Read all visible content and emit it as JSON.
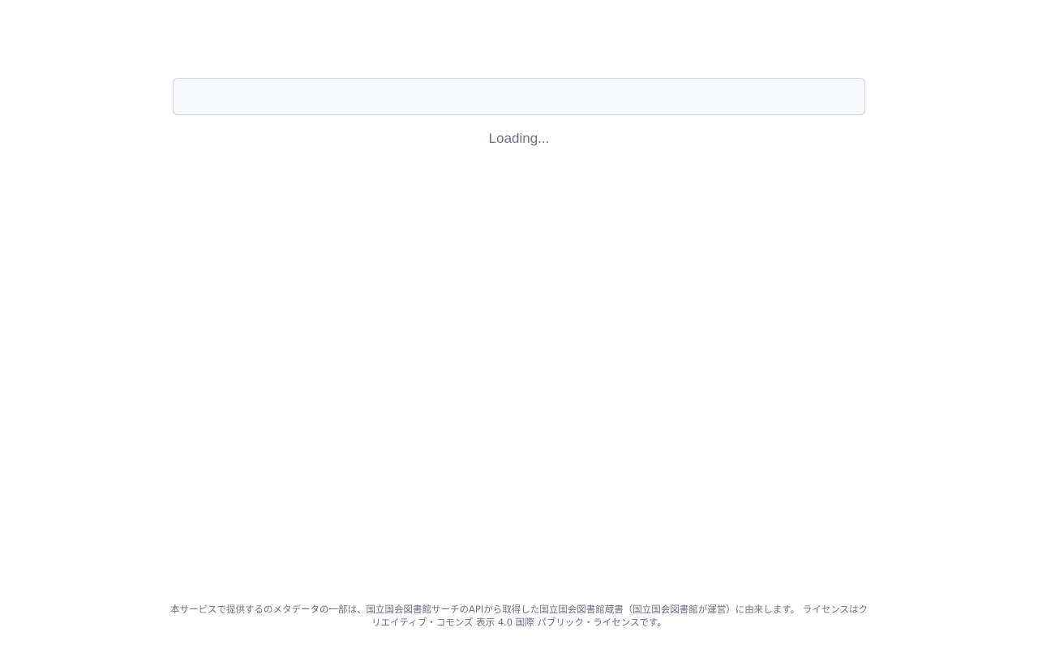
{
  "search": {
    "value": "",
    "placeholder": ""
  },
  "status": {
    "loading_text": "Loading..."
  },
  "footer": {
    "attribution_text": "本サービスで提供するのメタデータの一部は、国立国会図書館サーチのAPIから取得した国立国会図書館蔵書（国立国会図書館が運営）に由来します。 ライセンスはクリエイティブ・コモンズ 表示 4.0 国際 パブリック・ライセンスです。"
  },
  "colors": {
    "background": "#ffffff",
    "search_background": "#f8f9fb",
    "search_border": "#d1d5db",
    "text_muted": "#6b7280"
  }
}
